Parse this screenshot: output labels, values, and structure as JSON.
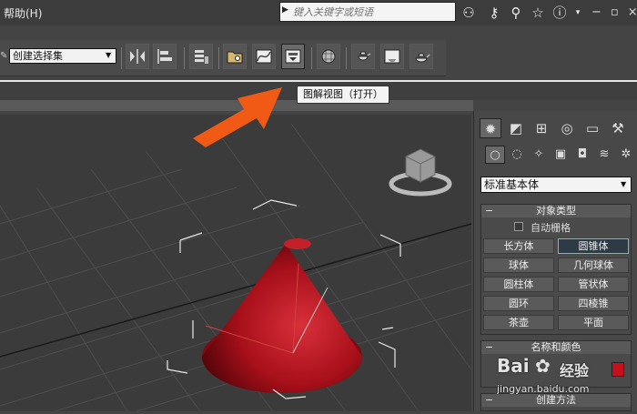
{
  "menu": {
    "help": "帮助(H)"
  },
  "search": {
    "placeholder": "键入关键字或短语"
  },
  "toolbar": {
    "selection_set": "创建选择集"
  },
  "tooltip": "图解视图（打开）",
  "panel": {
    "primitive_type": "标准基本体",
    "object_type": {
      "title": "对象类型",
      "autogrid": "自动栅格",
      "buttons": [
        "长方体",
        "圆锥体",
        "球体",
        "几何球体",
        "圆柱体",
        "管状体",
        "圆环",
        "四棱锥",
        "茶壶",
        "平面"
      ],
      "selected": "圆锥体"
    },
    "name_color": {
      "title": "名称和颜色",
      "color": "#c8101a"
    },
    "creation_method": {
      "title": "创建方法"
    }
  },
  "watermark": {
    "logo": "Bai",
    "text": "经验",
    "url": "jingyan.baidu.com"
  },
  "colors": {
    "cone": "#b0121c",
    "arrow": "#f05a14",
    "viewport_bg": "#3b3b3b"
  }
}
